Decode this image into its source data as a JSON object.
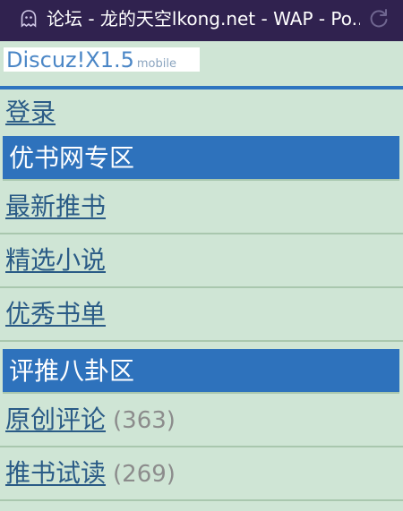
{
  "window": {
    "title": "论坛 - 龙的天空lkong.net - WAP - Po..."
  },
  "logo": {
    "main": "Discuz!X1.5",
    "sub": "mobile"
  },
  "nav": {
    "login": "登录"
  },
  "sections": [
    {
      "title": "优书网专区",
      "items": [
        {
          "label": "最新推书",
          "count": ""
        },
        {
          "label": "精选小说",
          "count": ""
        },
        {
          "label": "优秀书单",
          "count": ""
        }
      ]
    },
    {
      "title": "评推八卦区",
      "items": [
        {
          "label": "原创评论",
          "count": "(363)"
        },
        {
          "label": "推书试读",
          "count": "(269)"
        }
      ]
    }
  ],
  "colors": {
    "title_bar": "#30224f",
    "page_bg": "#cfe5d5",
    "section_header": "#2e72bc",
    "link": "#2a5b86",
    "count": "#8c8c8c"
  }
}
